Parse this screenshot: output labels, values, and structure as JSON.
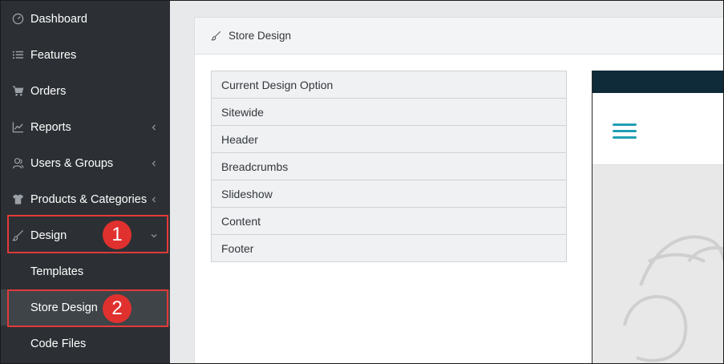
{
  "sidebar": {
    "items": [
      {
        "label": "Dashboard",
        "icon": "dashboard-icon"
      },
      {
        "label": "Features",
        "icon": "list-icon"
      },
      {
        "label": "Orders",
        "icon": "cart-icon"
      },
      {
        "label": "Reports",
        "icon": "chart-icon"
      },
      {
        "label": "Users & Groups",
        "icon": "users-icon"
      },
      {
        "label": "Products & Categories",
        "icon": "shirt-icon"
      },
      {
        "label": "Design",
        "icon": "brush-icon"
      }
    ],
    "subitems": [
      {
        "label": "Templates"
      },
      {
        "label": "Store Design"
      },
      {
        "label": "Code Files"
      }
    ]
  },
  "annotations": {
    "badge1": "1",
    "badge2": "2",
    "color": "#e0312f"
  },
  "card": {
    "title": "Store Design",
    "icon": "brush-icon"
  },
  "options": [
    "Current Design Option",
    "Sitewide",
    "Header",
    "Breadcrumbs",
    "Slideshow",
    "Content",
    "Footer"
  ],
  "preview": {
    "icon": "hamburger-menu-icon",
    "accent": "#1f9fb3",
    "topbar_color": "#0f2a38"
  }
}
